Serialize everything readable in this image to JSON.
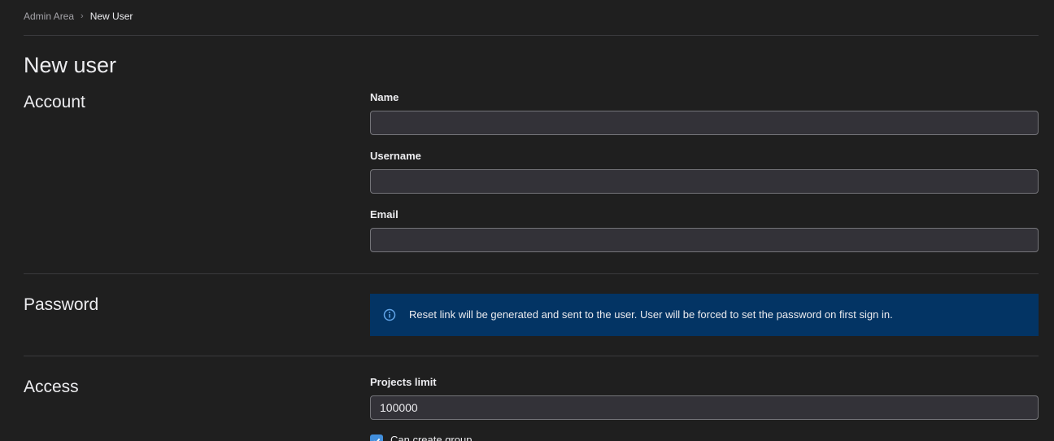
{
  "breadcrumb": {
    "parent": "Admin Area",
    "current": "New User"
  },
  "page_title": "New user",
  "account": {
    "title": "Account",
    "name_label": "Name",
    "name_value": "",
    "username_label": "Username",
    "username_value": "",
    "email_label": "Email",
    "email_value": ""
  },
  "password": {
    "title": "Password",
    "alert_text": "Reset link will be generated and sent to the user. User will be forced to set the password on first sign in.",
    "alert_icon": "info-icon"
  },
  "access": {
    "title": "Access",
    "projects_limit_label": "Projects limit",
    "projects_limit_value": "100000",
    "can_create_group_label": "Can create group",
    "can_create_group_checked": true
  },
  "colors": {
    "background": "#1f1f1f",
    "alert_background": "#033464",
    "accent": "#428fdc"
  }
}
